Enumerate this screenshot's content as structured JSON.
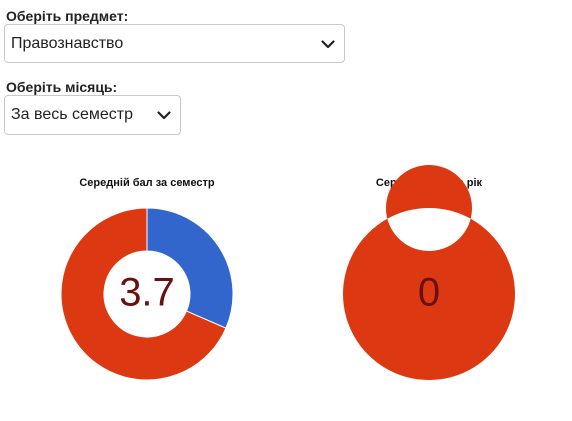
{
  "subject": {
    "label": "Оберіть предмет:",
    "value": "Правознавство",
    "icon": "chevron-down-icon"
  },
  "month": {
    "label": "Оберіть місяць:",
    "value": "За весь семестр",
    "icon": "chevron-down-icon"
  },
  "colors": {
    "primary": "#dc3912",
    "secondary": "#3366cc",
    "center_text": "#6b0f0f"
  },
  "chart_data": [
    {
      "type": "pie",
      "title": "Середній бал за семестр",
      "center_value": "3.7",
      "values": [
        0.315,
        0.685
      ],
      "colors": [
        "#3366cc",
        "#dc3912"
      ]
    },
    {
      "type": "pie",
      "title": "Середній бал за рік",
      "center_value": "0",
      "values": [
        1
      ],
      "colors": [
        "#dc3912"
      ]
    }
  ]
}
